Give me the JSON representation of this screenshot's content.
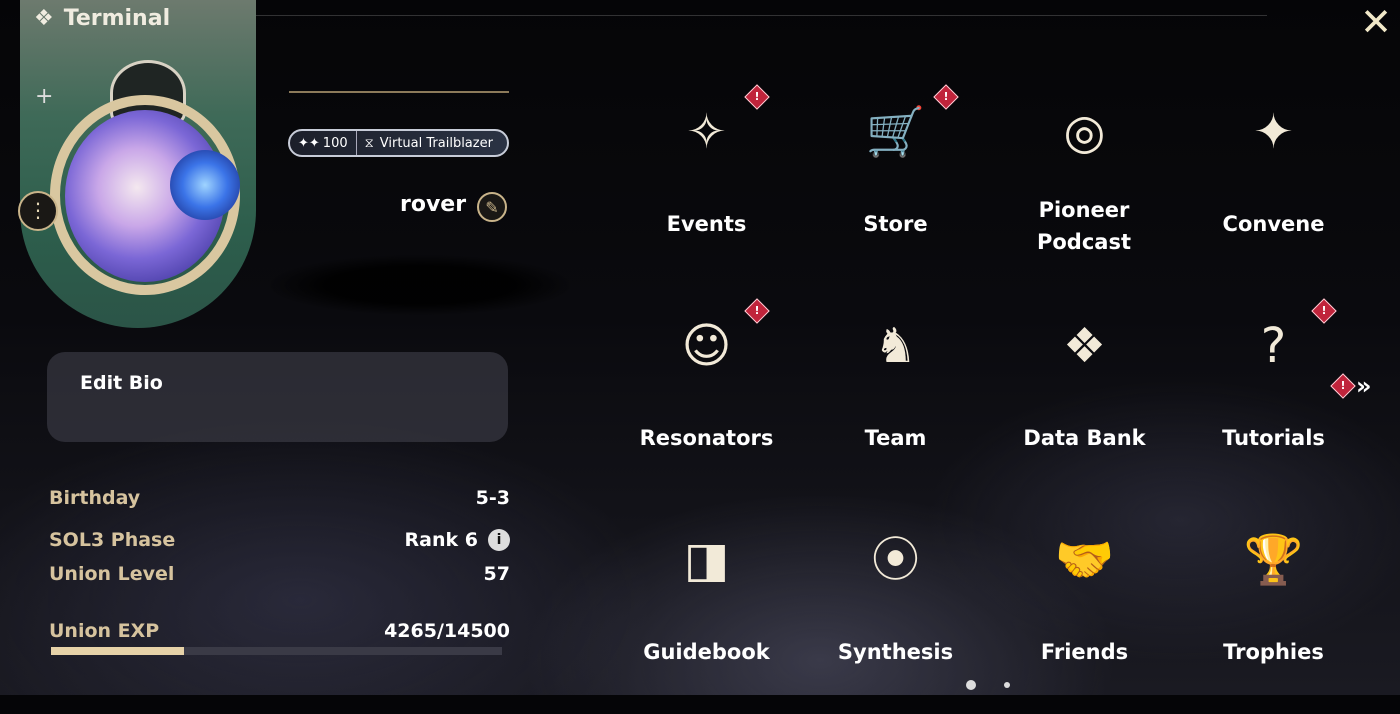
{
  "window": {
    "title": "Terminal"
  },
  "profile": {
    "name": "rover",
    "badge_count": "100",
    "badge_title": "Virtual Trailblazer",
    "bio_label": "Edit Bio"
  },
  "stats": [
    {
      "label": "Birthday",
      "value": "5-3"
    },
    {
      "label": "SOL3 Phase",
      "value": "Rank 6"
    },
    {
      "label": "Union Level",
      "value": "57"
    },
    {
      "label": "Union EXP",
      "value": "4265/14500"
    }
  ],
  "exp_progress": 0.294,
  "grid": [
    {
      "label": "Events",
      "icon": "events-icon",
      "alert": true
    },
    {
      "label": "Store",
      "icon": "store-icon",
      "alert": true
    },
    {
      "label": "Pioneer Podcast",
      "icon": "podcast-icon",
      "alert": false
    },
    {
      "label": "Convene",
      "icon": "convene-icon",
      "alert": false
    },
    {
      "label": "Resonators",
      "icon": "resonators-icon",
      "alert": true
    },
    {
      "label": "Team",
      "icon": "team-icon",
      "alert": false
    },
    {
      "label": "Data Bank",
      "icon": "data-bank-icon",
      "alert": false
    },
    {
      "label": "Tutorials",
      "icon": "tutorials-icon",
      "alert": true
    },
    {
      "label": "Guidebook",
      "icon": "guidebook-icon",
      "alert": false
    },
    {
      "label": "Synthesis",
      "icon": "synthesis-icon",
      "alert": false
    },
    {
      "label": "Friends",
      "icon": "friends-icon",
      "alert": false
    },
    {
      "label": "Trophies",
      "icon": "trophies-icon",
      "alert": false
    }
  ],
  "colors": {
    "accent": "#d6c39e",
    "alert": "#c0243b"
  }
}
